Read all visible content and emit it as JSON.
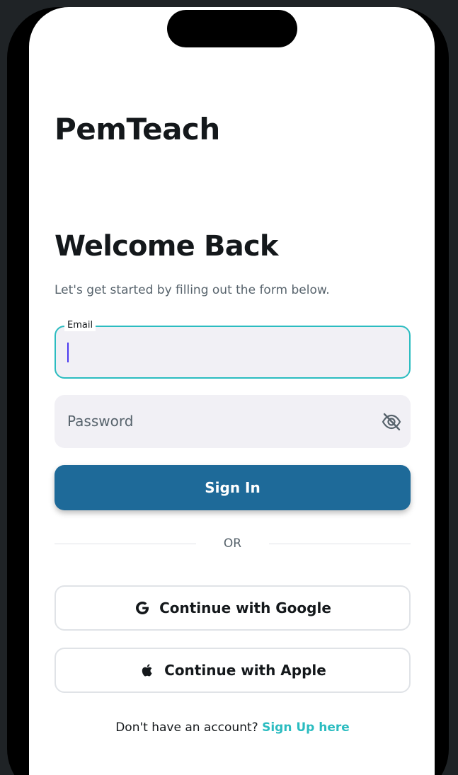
{
  "app": {
    "title": "PemTeach"
  },
  "login": {
    "heading": "Welcome Back",
    "subheading": "Let's get started by filling out the form below.",
    "email": {
      "label": "Email",
      "value": ""
    },
    "password": {
      "placeholder": "Password",
      "value": ""
    },
    "signin_label": "Sign In",
    "divider_text": "OR",
    "google_label": "Continue with Google",
    "apple_label": "Continue with Apple",
    "signup_prompt": "Don't have an account?",
    "signup_link": "Sign Up here"
  },
  "icons": {
    "eye": "eye-off-icon",
    "google": "google-icon",
    "apple": "apple-icon"
  },
  "colors": {
    "primary": "#1e6a99",
    "accent": "#2bbcc0",
    "text_primary": "#14181b",
    "text_secondary": "#57636c",
    "input_bg": "#f1f0f5"
  }
}
